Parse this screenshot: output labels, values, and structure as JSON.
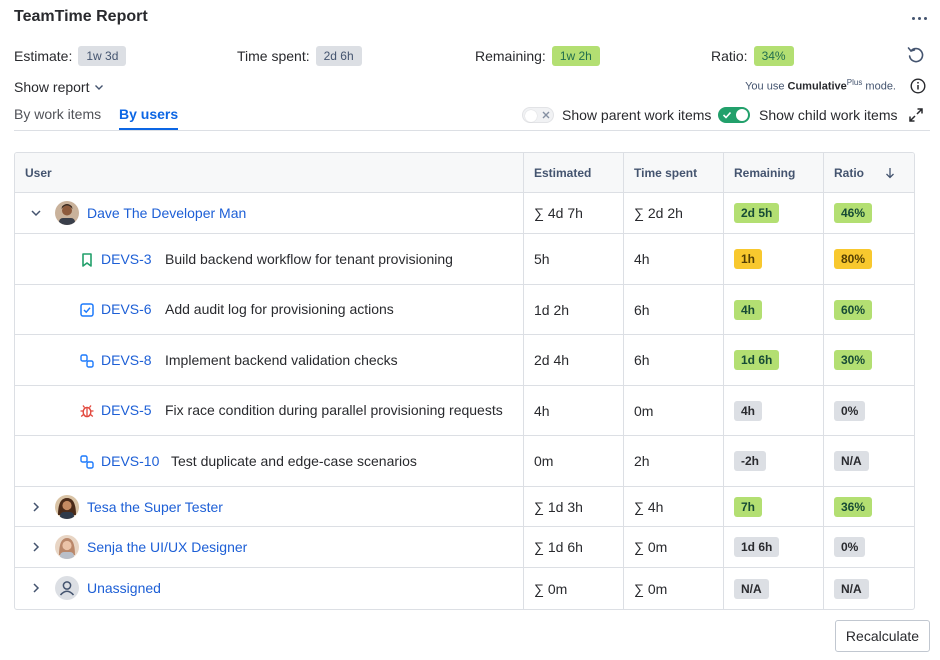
{
  "app": {
    "title": "TeamTime Report"
  },
  "stats": {
    "estimate": {
      "label": "Estimate:",
      "value": "1w 3d"
    },
    "time_spent": {
      "label": "Time spent:",
      "value": "2d 6h"
    },
    "remaining": {
      "label": "Remaining:",
      "value": "1w 2h"
    },
    "ratio": {
      "label": "Ratio:",
      "value": "34%"
    }
  },
  "show_report": "Show report",
  "mode": {
    "prefix": "You use ",
    "name": "Cumulative",
    "sup": "Plus",
    "suffix": " mode."
  },
  "tabs": [
    {
      "label": "By work items",
      "active": false
    },
    {
      "label": "By users",
      "active": true
    }
  ],
  "toggles": {
    "parent": {
      "label": "Show parent work items",
      "on": false
    },
    "child": {
      "label": "Show child work items",
      "on": true
    }
  },
  "table": {
    "headers": {
      "user": "User",
      "estimated": "Estimated",
      "time_spent": "Time spent",
      "remaining": "Remaining",
      "ratio": "Ratio"
    },
    "users": [
      {
        "name": "Dave The Developer Man",
        "expanded": true,
        "estimated": "∑ 4d 7h",
        "time_spent": "∑ 2d 2h",
        "remaining": "2d 5h",
        "ratio": "46%",
        "items": [
          {
            "icon": "bookmark-icon",
            "key": "DEVS-3",
            "summary": "Build backend workflow for tenant provisioning",
            "estimated": "5h",
            "time_spent": "4h",
            "remaining": "1h",
            "ratio": "80%"
          },
          {
            "icon": "task-icon",
            "key": "DEVS-6",
            "summary": "Add audit log for provisioning actions",
            "estimated": "1d 2h",
            "time_spent": "6h",
            "remaining": "4h",
            "ratio": "60%"
          },
          {
            "icon": "subtask-icon",
            "key": "DEVS-8",
            "summary": "Implement backend validation checks",
            "estimated": "2d 4h",
            "time_spent": "6h",
            "remaining": "1d 6h",
            "ratio": "30%"
          },
          {
            "icon": "bug-icon",
            "key": "DEVS-5",
            "summary": "Fix race condition during parallel provisioning requests",
            "estimated": "4h",
            "time_spent": "0m",
            "remaining": "4h",
            "ratio": "0%"
          },
          {
            "icon": "subtask-icon",
            "key": "DEVS-10",
            "summary": "Test duplicate and edge-case scenarios",
            "estimated": "0m",
            "time_spent": "2h",
            "remaining": "-2h",
            "ratio": "N/A"
          }
        ]
      },
      {
        "name": "Tesa the Super Tester",
        "expanded": false,
        "estimated": "∑ 1d 3h",
        "time_spent": "∑ 4h",
        "remaining": "7h",
        "ratio": "36%"
      },
      {
        "name": "Senja the UI/UX Designer",
        "expanded": false,
        "estimated": "∑ 1d 6h",
        "time_spent": "∑ 0m",
        "remaining": "1d 6h",
        "ratio": "0%"
      },
      {
        "name": "Unassigned",
        "expanded": false,
        "estimated": "∑ 0m",
        "time_spent": "∑ 0m",
        "remaining": "N/A",
        "ratio": "N/A"
      }
    ]
  },
  "recalculate": "Recalculate",
  "colors": {
    "link": "#1D5FD6",
    "green_badge": "#B3DF72",
    "yellow_badge": "#F8C82E",
    "gray_badge": "#DCDFE4",
    "toggle_on": "#22A06B"
  }
}
